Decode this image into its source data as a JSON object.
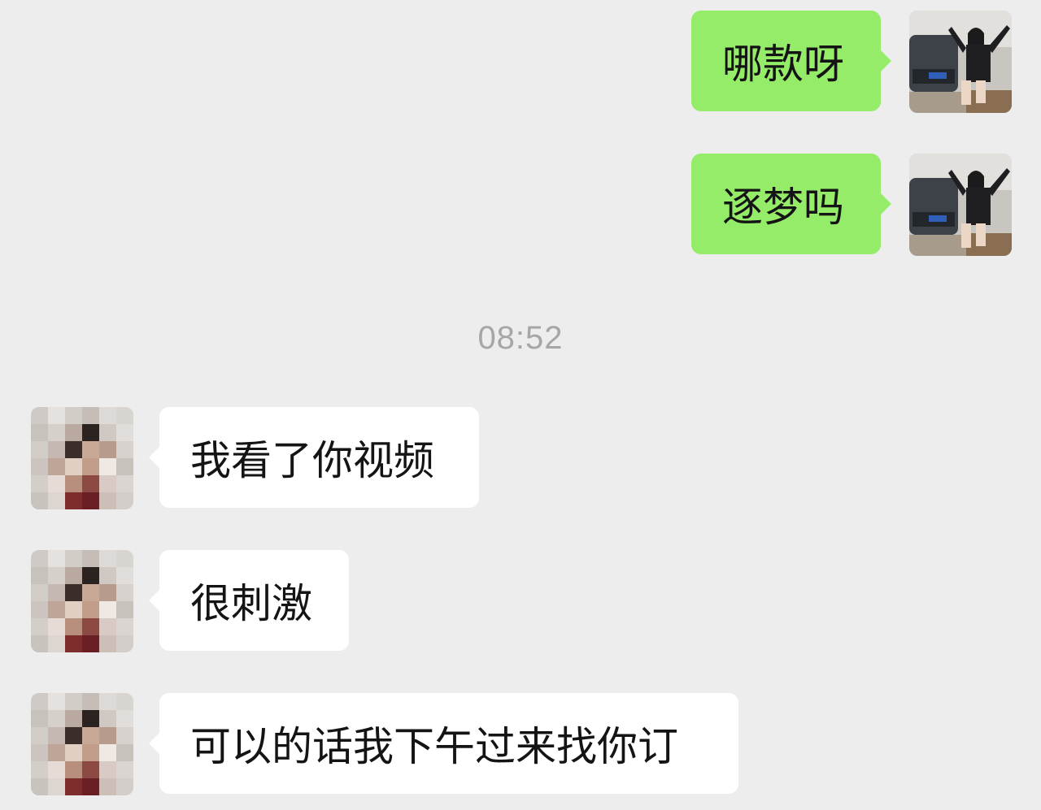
{
  "timestamp": "08:52",
  "messages": [
    {
      "direction": "outgoing",
      "text": "哪款呀",
      "avatar": "self-avatar-photo"
    },
    {
      "direction": "outgoing",
      "text": "逐梦吗",
      "avatar": "self-avatar-photo"
    },
    {
      "direction": "incoming",
      "text": "我看了你视频",
      "avatar": "contact-avatar-pixelated"
    },
    {
      "direction": "incoming",
      "text": "很刺激",
      "avatar": "contact-avatar-pixelated"
    },
    {
      "direction": "incoming",
      "text": "可以的话我下午过来找你订",
      "avatar": "contact-avatar-pixelated"
    }
  ],
  "colors": {
    "background": "#ededed",
    "outgoing_bubble": "#95ec69",
    "incoming_bubble": "#ffffff",
    "timestamp_text": "#a6a6a6"
  }
}
